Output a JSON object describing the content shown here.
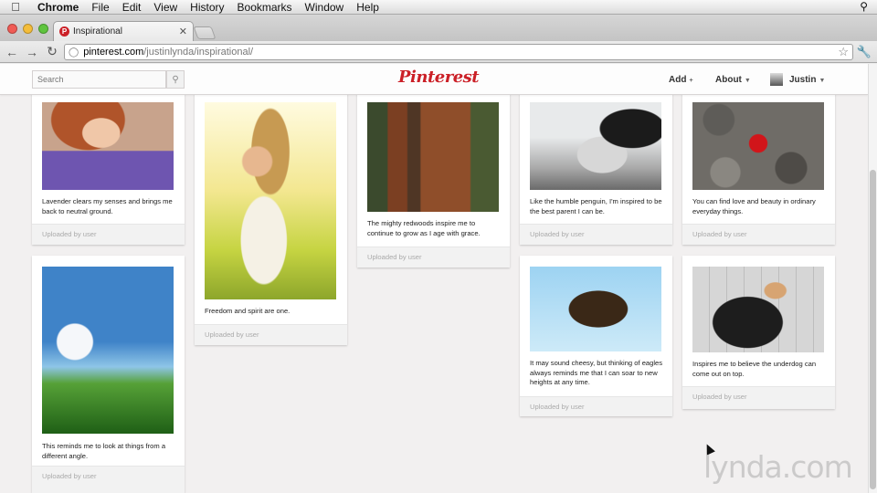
{
  "menubar": {
    "app": "Chrome",
    "items": [
      "File",
      "Edit",
      "View",
      "History",
      "Bookmarks",
      "Window",
      "Help"
    ]
  },
  "browser": {
    "tab_title": "Inspirational",
    "url_host": "pinterest.com",
    "url_path": "/justinlynda/inspirational/"
  },
  "pinterest": {
    "search_placeholder": "Search",
    "logo": "Pinterest",
    "nav": {
      "add": "Add",
      "about": "About",
      "user": "Justin"
    }
  },
  "pins": [
    {
      "image": "lavender",
      "description": "Lavender clears my senses and brings me back to neutral ground.",
      "footer": "Uploaded by user"
    },
    {
      "image": "girl",
      "description": "Freedom and spirit are one.",
      "footer": "Uploaded by user"
    },
    {
      "image": "redwood",
      "description": "The mighty redwoods inspire me to continue to grow as I age with grace.",
      "footer": "Uploaded by user"
    },
    {
      "image": "penguin",
      "description": "Like the humble penguin, I'm inspired to be the best parent I can be.",
      "footer": "Uploaded by user"
    },
    {
      "image": "heart-stone",
      "description": "You can find love and beauty in ordinary everyday things.",
      "footer": "Uploaded by user"
    },
    {
      "image": "dandelion",
      "description": "This reminds me to look at things from a different angle.",
      "footer": "Uploaded by user"
    },
    {
      "image": "eagle",
      "description": "It may sound cheesy, but thinking of eagles always reminds me that I can soar to new heights at any time.",
      "footer": "Uploaded by user"
    },
    {
      "image": "dog",
      "description": "Inspires me to believe the underdog can come out on top.",
      "footer": "Uploaded by user"
    }
  ],
  "watermark": "lynda.com",
  "colors": {
    "pinterest_red": "#cb2027",
    "page_bg": "#f2f0f0"
  }
}
